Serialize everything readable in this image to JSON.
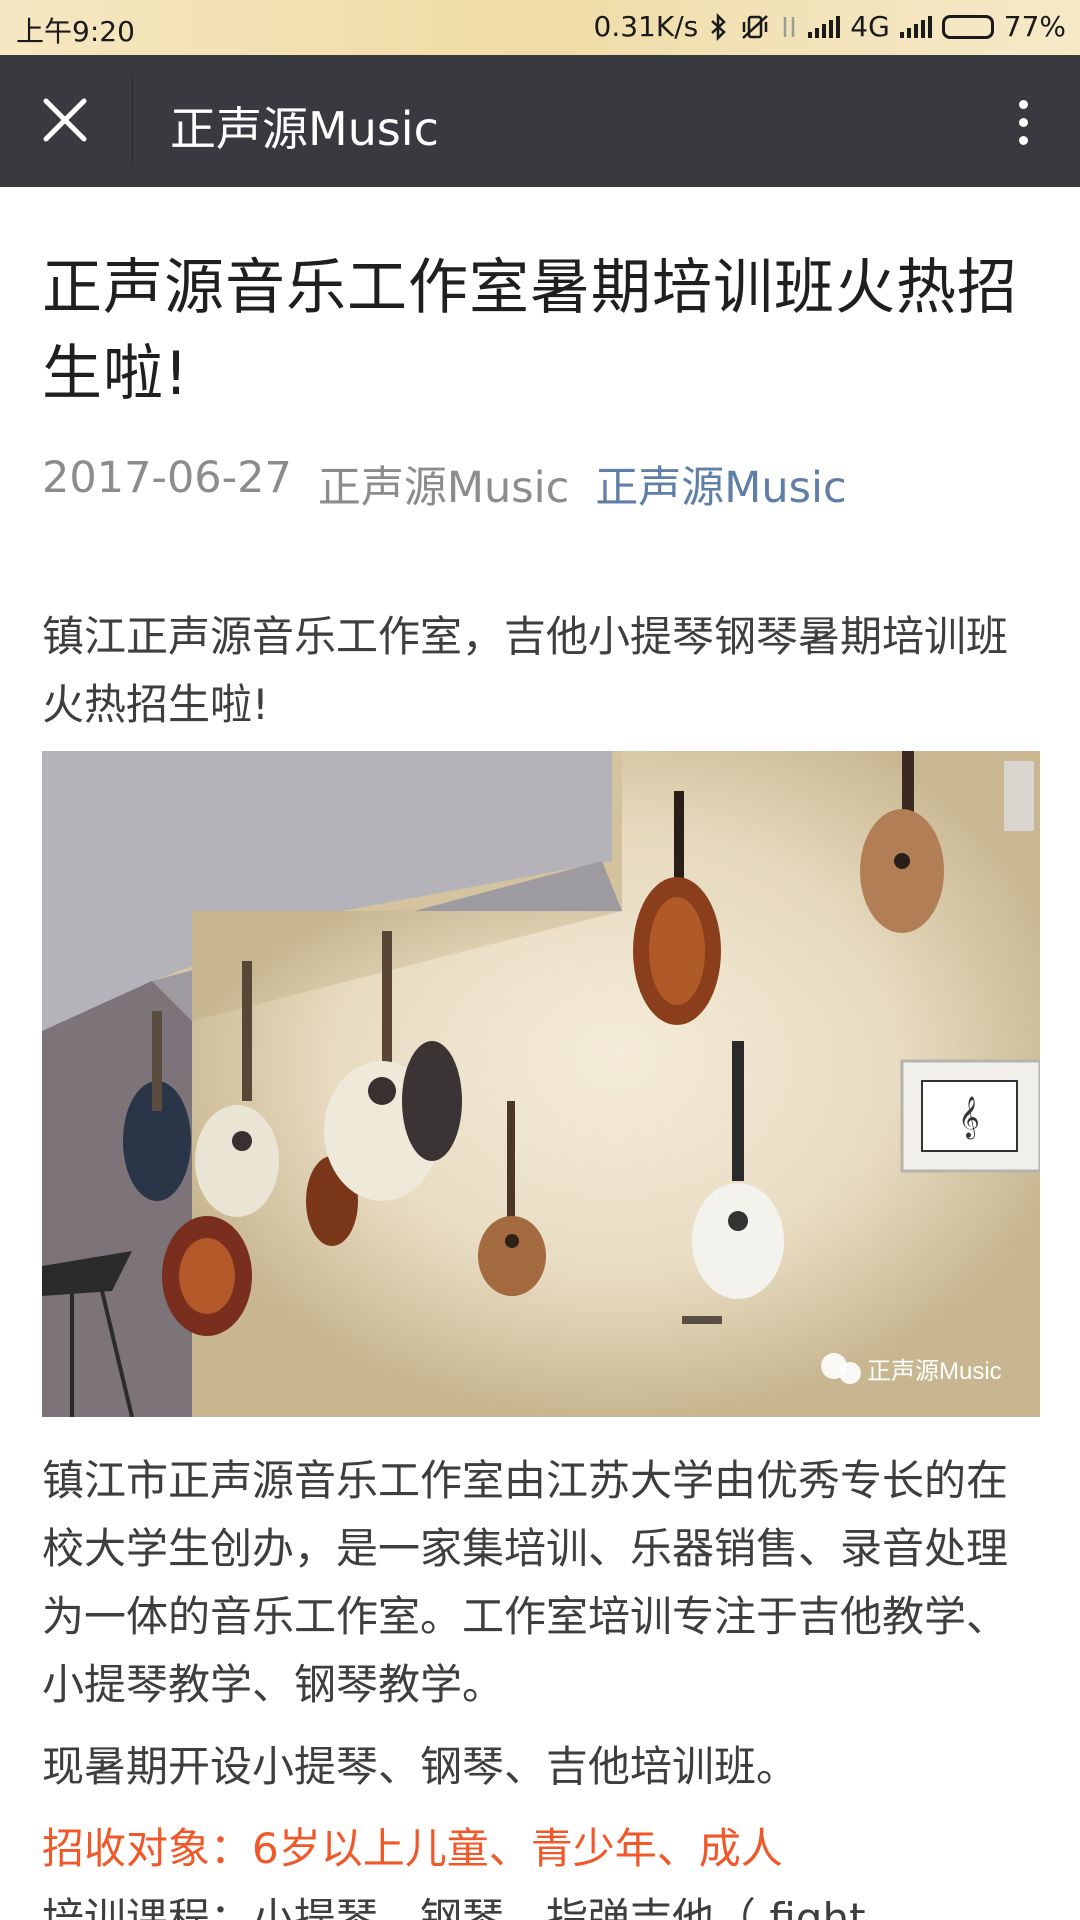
{
  "status_bar": {
    "time": "上午9:20",
    "speed": "0.31K/s",
    "network": "4G",
    "battery": "77%",
    "battery_level": 0.77
  },
  "navbar": {
    "title": "正声源Music",
    "close_icon": "close-icon",
    "more_icon": "more-vertical-icon"
  },
  "article": {
    "title": "正声源音乐工作室暑期培训班火热招生啦!",
    "date": "2017-06-27",
    "author": "正声源Music",
    "account_link": "正声源Music",
    "intro": "镇江正声源音乐工作室，吉他小提琴钢琴暑期培训班火热招生啦!",
    "photo_watermark": "正声源Music",
    "paragraph_1": "镇江市正声源音乐工作室由江苏大学由优秀专长的在校大学生创办，是一家集培训、乐器销售、录音处理为一体的音乐工作室。工作室培训专注于吉他教学、小提琴教学、钢琴教学。",
    "paragraph_2": "现暑期开设小提琴、钢琴、吉他培训班。",
    "target_line": "招收对象：6岁以上儿童、青少年、成人",
    "courses_line": "培训课程：小提琴，钢琴，指弹吉他（ fight，",
    "highlight_color": "#f0582a",
    "link_color": "#607fa6"
  }
}
